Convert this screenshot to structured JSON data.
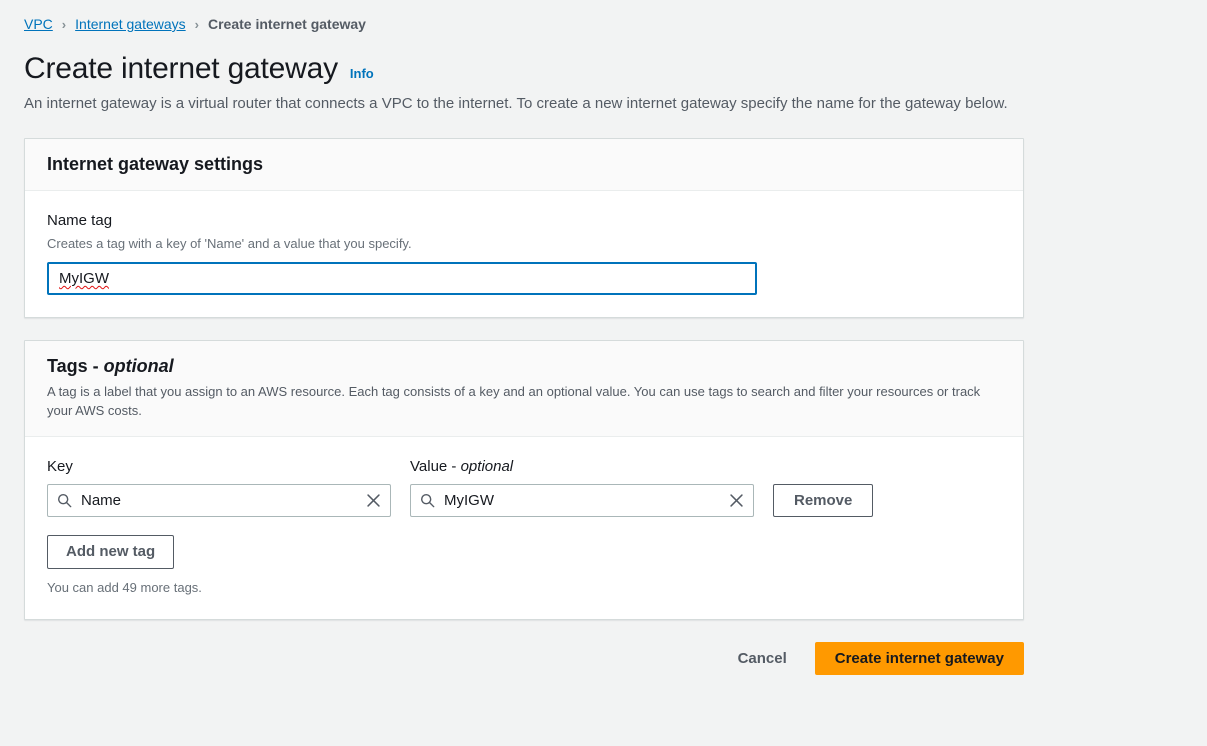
{
  "breadcrumb": {
    "items": [
      {
        "label": "VPC",
        "type": "link"
      },
      {
        "label": "Internet gateways",
        "type": "link"
      },
      {
        "label": "Create internet gateway",
        "type": "current"
      }
    ],
    "separator": "›"
  },
  "header": {
    "title": "Create internet gateway",
    "info_label": "Info",
    "description": "An internet gateway is a virtual router that connects a VPC to the internet. To create a new internet gateway specify the name for the gateway below."
  },
  "settings_card": {
    "title": "Internet gateway settings",
    "name_tag": {
      "label": "Name tag",
      "hint": "Creates a tag with a key of 'Name' and a value that you specify.",
      "value": "MyIGW",
      "placeholder": ""
    }
  },
  "tags_card": {
    "title_main": "Tags - ",
    "title_optional": "optional",
    "description": "A tag is a label that you assign to an AWS resource. Each tag consists of a key and an optional value. You can use tags to search and filter your resources or track your AWS costs.",
    "columns": {
      "key_label": "Key",
      "value_label_main": "Value - ",
      "value_label_optional": "optional"
    },
    "rows": [
      {
        "key": "Name",
        "value": "MyIGW",
        "remove_label": "Remove",
        "key_icon": "search-icon",
        "key_clear_icon": "clear-icon",
        "value_icon": "search-icon",
        "value_clear_icon": "clear-icon"
      }
    ],
    "add_tag_label": "Add new tag",
    "remaining_hint": "You can add 49 more tags."
  },
  "footer": {
    "cancel_label": "Cancel",
    "submit_label": "Create internet gateway"
  },
  "colors": {
    "page_background": "#f2f3f3",
    "card_background": "#ffffff",
    "card_header_background": "#fafafa",
    "card_border": "#d5dbdb",
    "link_blue": "#0073bb",
    "focus_blue": "#0073bb",
    "text_primary": "#16191f",
    "text_secondary": "#545b64",
    "text_hint": "#687078",
    "input_border": "#aab7b8",
    "primary_button": "#ff9900",
    "spellcheck_underline": "#e01010"
  }
}
